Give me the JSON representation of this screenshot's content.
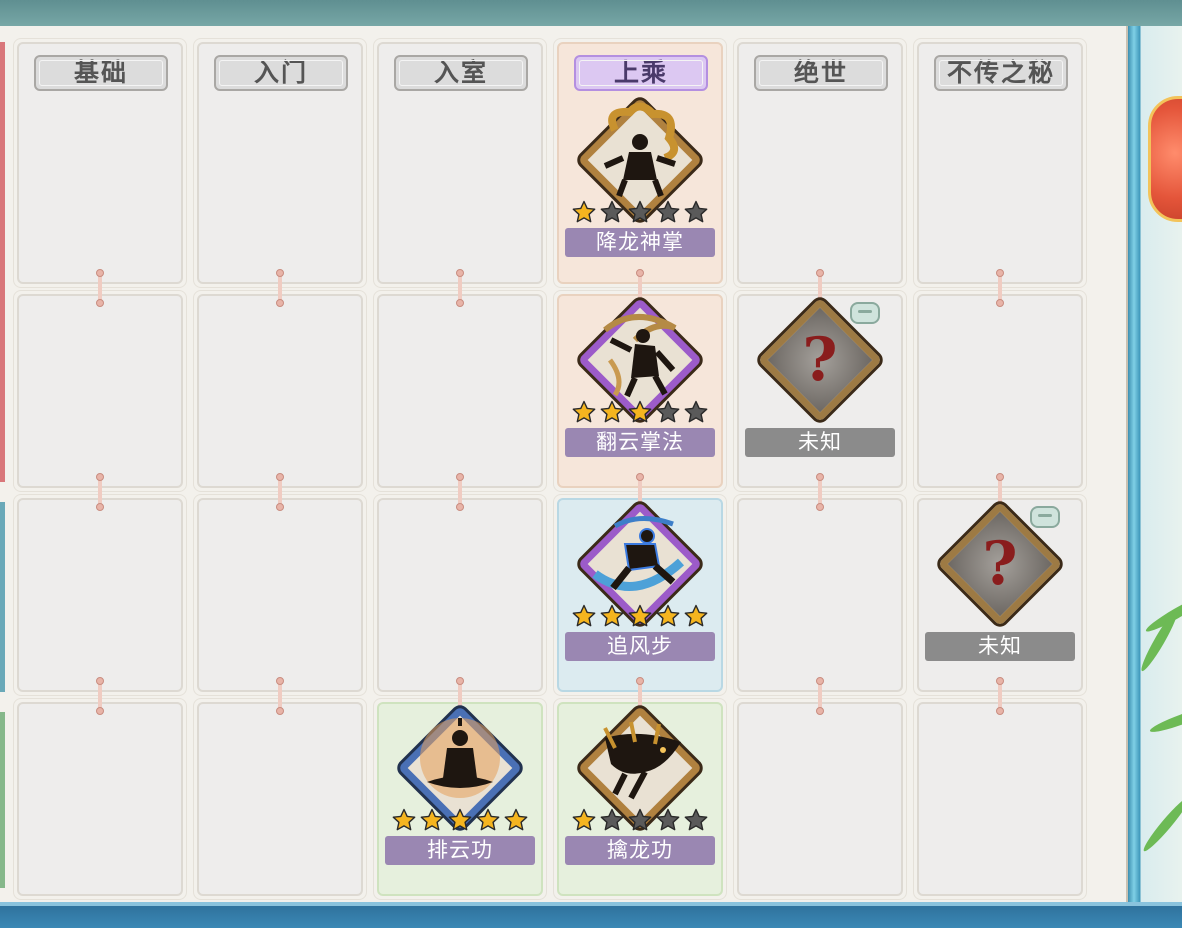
{
  "colors": {
    "accent_purple": "#dcc8f2",
    "nameplate_purple": "#9a87b2",
    "nameplate_grey": "#8b8b8b",
    "star_gold": "#f5b51f",
    "star_empty": "#5a5a5a"
  },
  "headers": [
    "基础",
    "入门",
    "入室",
    "上乘",
    "绝世",
    "不传之秘"
  ],
  "active_tier_index": 3,
  "skills": [
    {
      "name": "降龙神掌",
      "tier": "上乘",
      "stars": 1,
      "max_stars": 5,
      "border": "gold",
      "icon": "golden-dragon-warrior-icon"
    },
    {
      "name": "翻云掌法",
      "tier": "上乘",
      "stars": 3,
      "max_stars": 5,
      "border": "purple",
      "icon": "whirling-palm-warrior-icon"
    },
    {
      "name": "追风步",
      "tier": "上乘",
      "stars": 5,
      "max_stars": 5,
      "border": "purple",
      "icon": "wind-chasing-runner-icon"
    },
    {
      "name": "排云功",
      "tier": "入室",
      "stars": 5,
      "max_stars": 5,
      "border": "blue",
      "icon": "meditating-monk-icon"
    },
    {
      "name": "擒龙功",
      "tier": "上乘",
      "stars": 1,
      "max_stars": 5,
      "border": "gold",
      "icon": "dragon-claw-icon"
    },
    {
      "name": "未知",
      "tier": "绝世",
      "unknown": true,
      "icon": "question-mark-icon"
    },
    {
      "name": "未知",
      "tier": "不传之秘",
      "unknown": true,
      "icon": "question-mark-icon"
    }
  ]
}
